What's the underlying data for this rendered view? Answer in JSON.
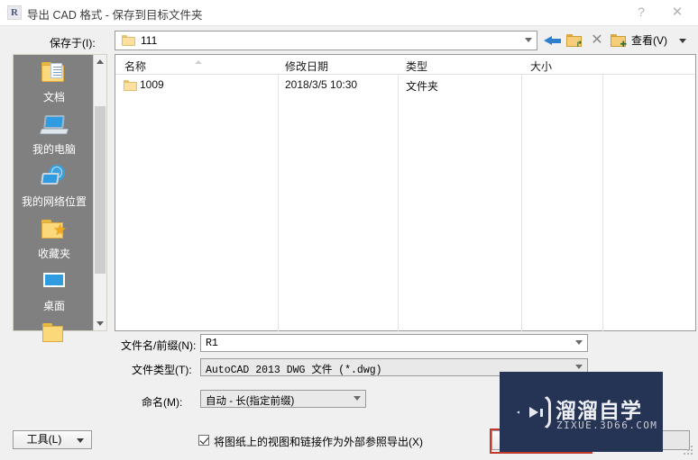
{
  "window": {
    "title": "导出 CAD 格式 - 保存到目标文件夹",
    "app_icon": "autodesk-r-icon",
    "help_glyph": "?",
    "close_glyph": "✕"
  },
  "path_bar": {
    "label": "保存于(I):",
    "current_folder": "111",
    "folder_icon": "folder-icon",
    "dropdown_icon": "chevron-down-icon"
  },
  "toolbar": {
    "back_icon": "back-arrow-icon",
    "up_icon": "up-folder-icon",
    "delete_icon": "delete-x-icon",
    "new_folder_icon": "new-folder-icon",
    "view_label": "查看(V)",
    "view_dropdown_icon": "chevron-down-icon"
  },
  "places": [
    {
      "label": "文档",
      "icon": "documents-folder-icon"
    },
    {
      "label": "我的电脑",
      "icon": "computer-icon"
    },
    {
      "label": "我的网络位置",
      "icon": "network-icon"
    },
    {
      "label": "收藏夹",
      "icon": "favorites-folder-icon"
    },
    {
      "label": "桌面",
      "icon": "desktop-icon"
    },
    {
      "label": "",
      "icon": "folder-icon"
    }
  ],
  "file_list": {
    "columns": [
      "名称",
      "修改日期",
      "类型",
      "大小"
    ],
    "sort_column": "名称",
    "sort_direction": "asc",
    "rows": [
      {
        "name": "1009",
        "modified": "2018/3/5 10:30",
        "type": "文件夹",
        "size": "",
        "icon": "folder-icon"
      }
    ]
  },
  "form": {
    "filename_label": "文件名/前缀(N):",
    "filename_value": "R1",
    "filetype_label": "文件类型(T):",
    "filetype_value": "AutoCAD 2013 DWG 文件   (*.dwg)",
    "naming_label": "命名(M):",
    "naming_value": "自动 - 长(指定前缀)"
  },
  "footer": {
    "tools_label": "工具(L)",
    "checkbox_label": "将图纸上的视图和链接作为外部参照导出(X)",
    "checkbox_checked": true,
    "save_label": "",
    "cancel_label": ""
  },
  "watermark": {
    "title": "溜溜自学",
    "subtitle": "ZIXUE.3D66.COM",
    "logo_icon": "play-triangle-icon",
    "bg_color": "#253355"
  },
  "highlight": {
    "color": "#c0392b"
  }
}
